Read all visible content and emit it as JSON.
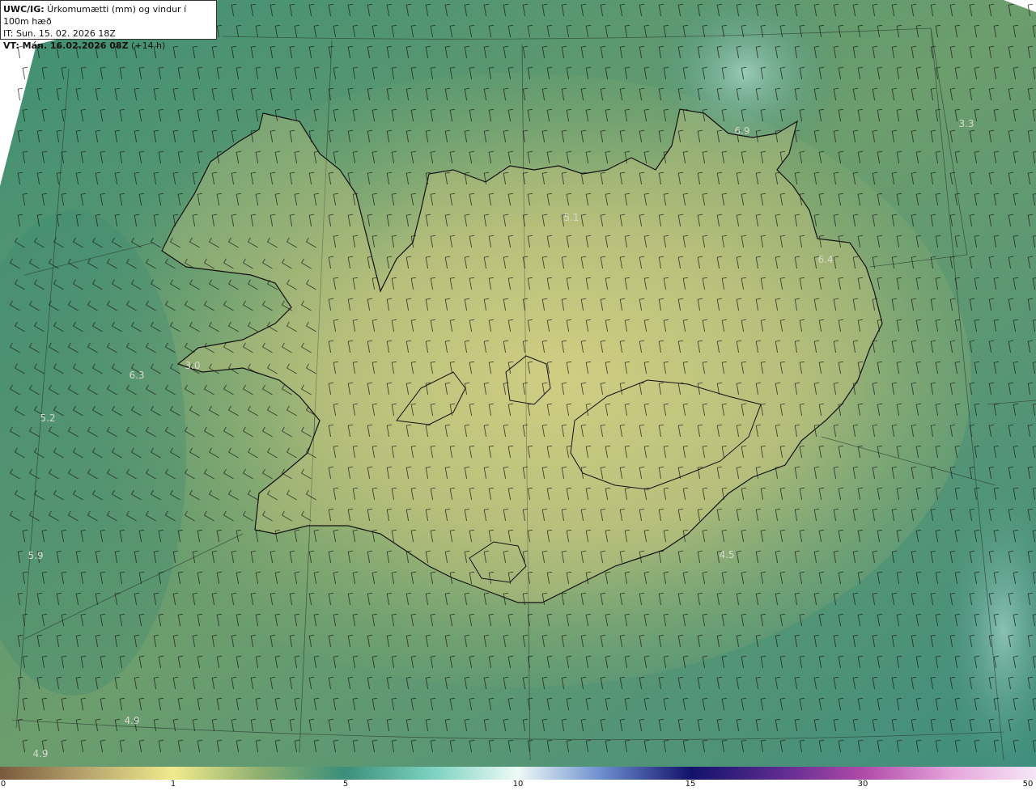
{
  "header": {
    "line1_bold": "UWC/IG:",
    "line1_rest": " Úrkomumætti (mm) og vindur í 100m hæð",
    "line2": "IT: Sun. 15. 02. 2026 18Z",
    "line3_bold": "VT: Mán. 16.02.2026 08Z",
    "line3_rest": " (+14 h)"
  },
  "colorbar": {
    "ticks": [
      "0",
      "1",
      "5",
      "10",
      "15",
      "30",
      "50"
    ],
    "colors": [
      "#7a5a3c",
      "#c9c07a",
      "#f3ec8a",
      "#7fae6e",
      "#3b8f7a",
      "#9fe3d8",
      "#eaf7f5",
      "#4b5fb0",
      "#10106a",
      "#7a3fa0",
      "#d060b8",
      "#e8a0d8",
      "#f4e0f4"
    ]
  },
  "map_values": [
    {
      "text": "6.9"
    },
    {
      "text": "3.3"
    },
    {
      "text": "5.1"
    },
    {
      "text": "6.4"
    },
    {
      "text": "3.0"
    },
    {
      "text": "6.3"
    },
    {
      "text": "5.2"
    },
    {
      "text": "5.9"
    },
    {
      "text": "4.5"
    },
    {
      "text": "4.9"
    },
    {
      "text": "4.9"
    }
  ]
}
